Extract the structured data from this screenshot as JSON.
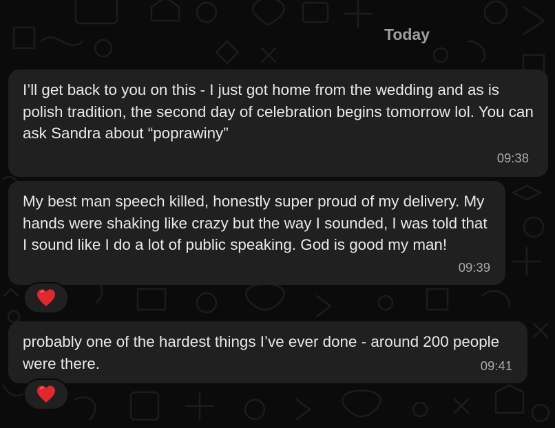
{
  "chat": {
    "date_separator": "Today",
    "messages": [
      {
        "text": "I’ll get back to you on this - I just got home from the wedding and as is polish tradition, the second day of celebration begins tomorrow lol. You can ask Sandra about “poprawiny”",
        "time": "09:38",
        "reaction": null
      },
      {
        "text": "My best man speech killed, honestly super proud of my delivery. My hands were shaking like crazy but the way I sounded, I was told that I sound like I do a lot of public speaking. God is good my man!",
        "time": "09:39",
        "reaction": "red-heart"
      },
      {
        "text": "probably one of the hardest things I’ve ever done - around 200 people were there.",
        "time": "09:41",
        "reaction": "red-heart"
      }
    ]
  },
  "colors": {
    "background": "#0b0b0b",
    "bubble": "#202020",
    "text": "#e6e8ea",
    "timestamp": "#a7a9ac",
    "date_chip_text": "#9c9fa3",
    "heart": "#e0282e"
  }
}
